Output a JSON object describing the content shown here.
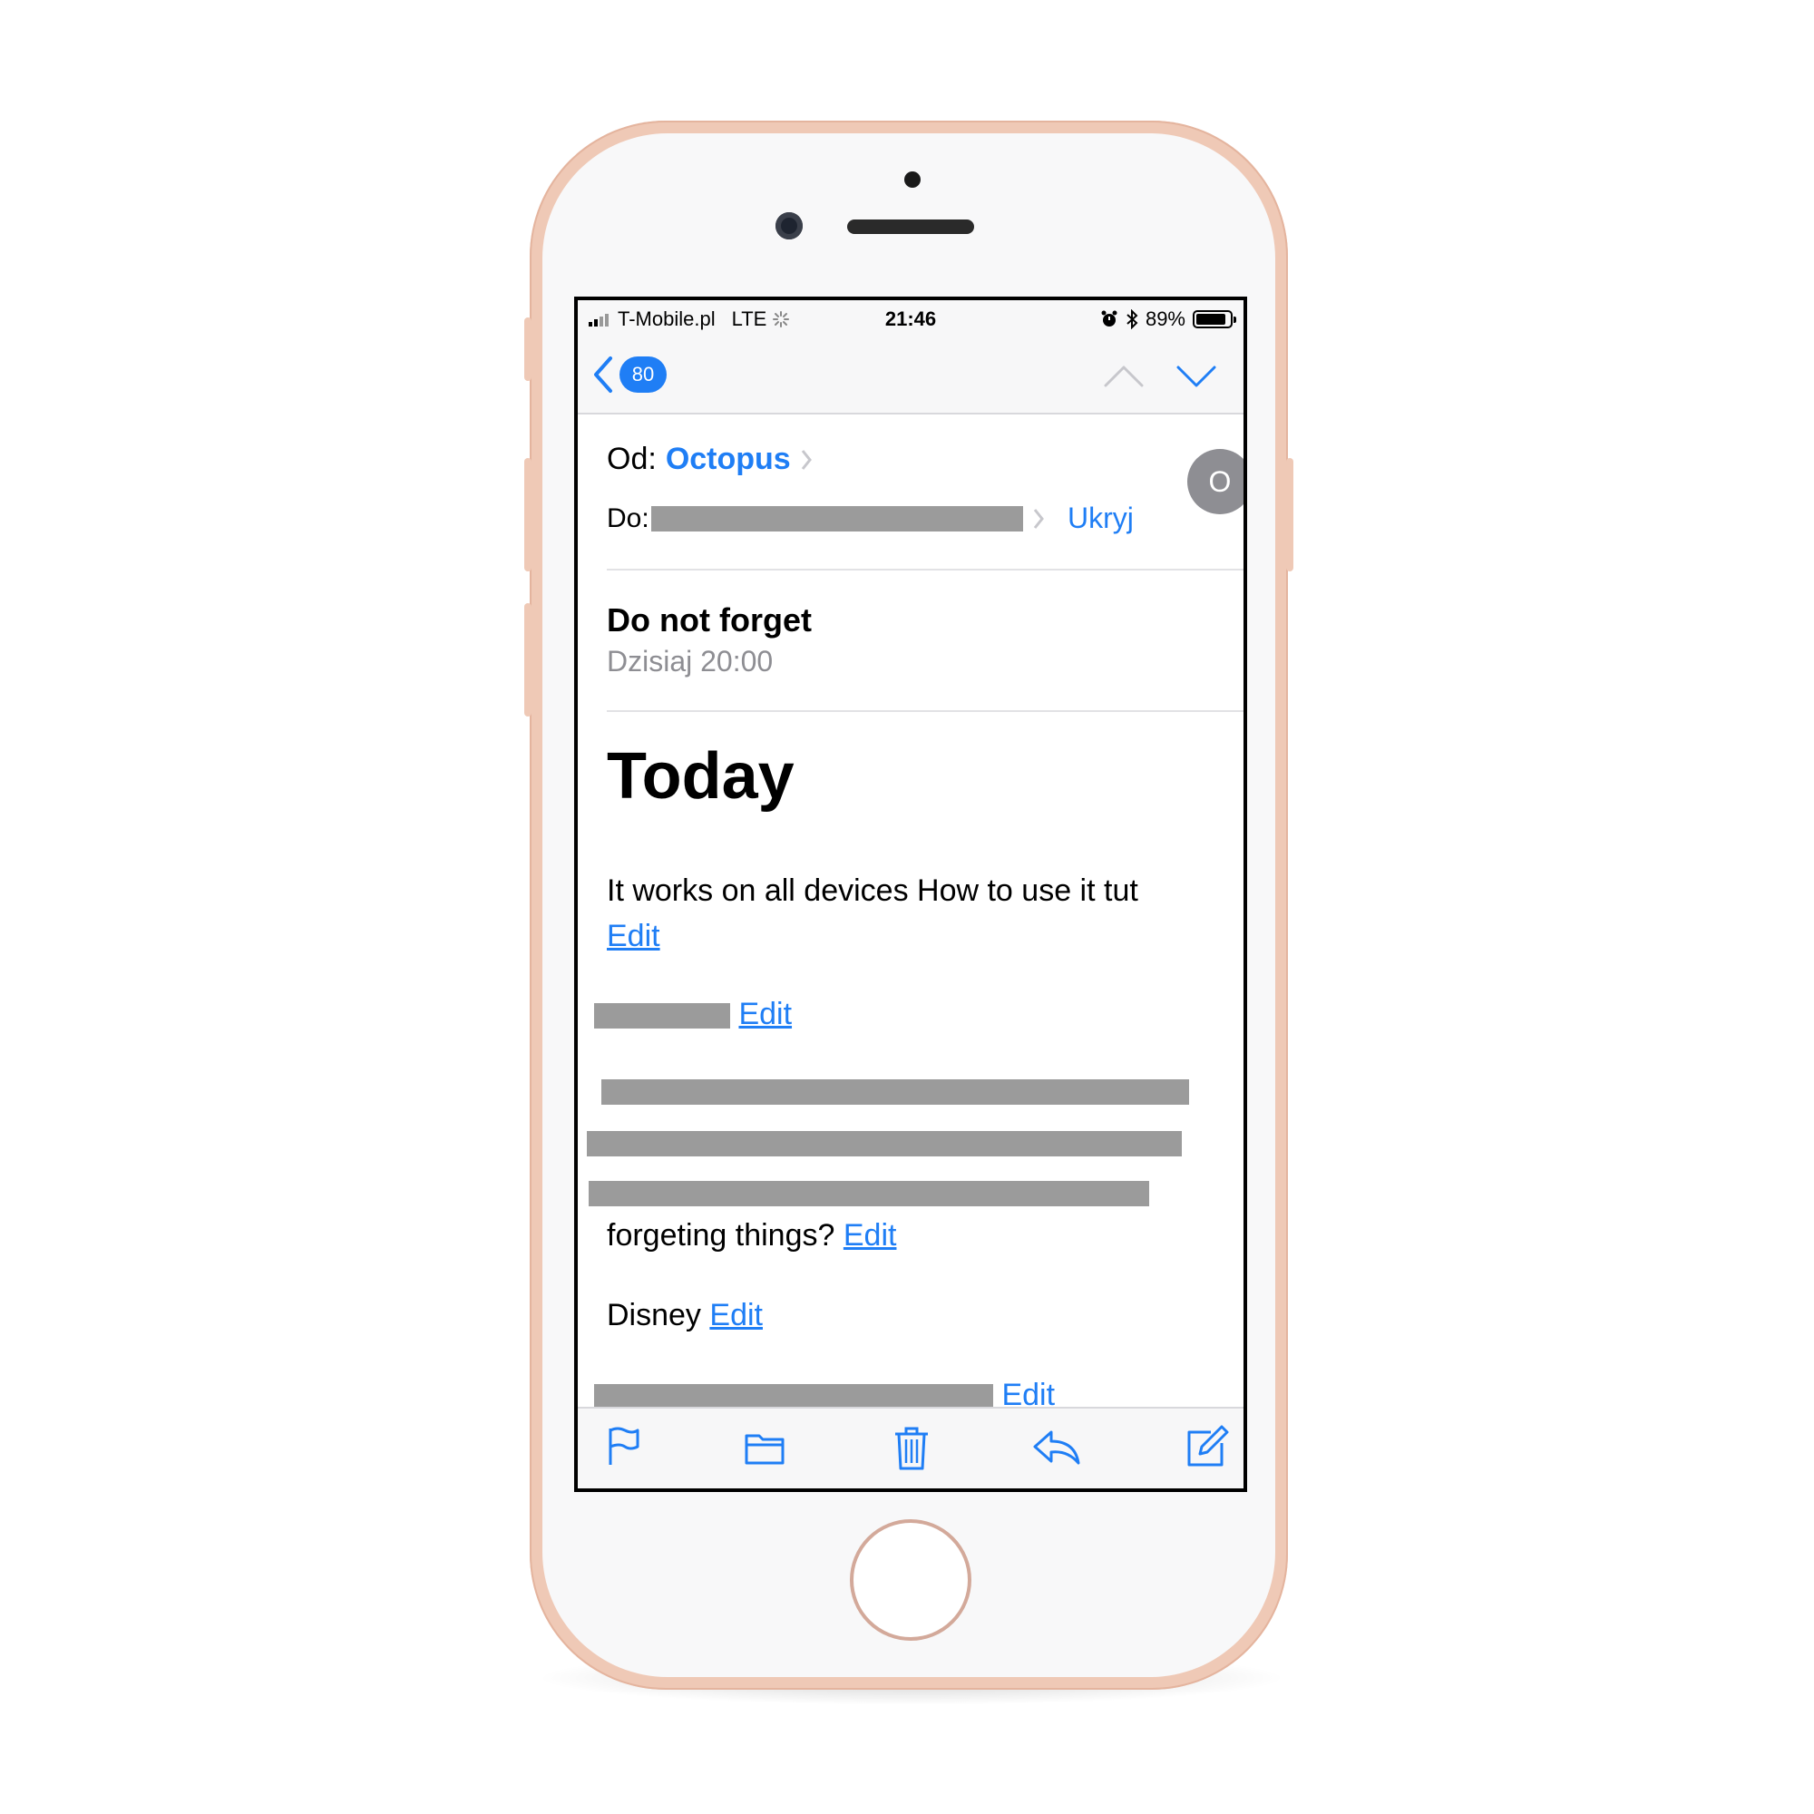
{
  "status": {
    "carrier": "T-Mobile.pl",
    "network": "LTE",
    "time": "21:46",
    "battery": "89%",
    "battery_level": 0.89
  },
  "nav": {
    "unread_count": "80"
  },
  "message": {
    "from_label": "Od:",
    "from_name": "Octopus",
    "to_label": "Do:",
    "hide_label": "Ukryj",
    "avatar_initial": "O",
    "subject": "Do not forget",
    "date": "Dzisiaj 20:00"
  },
  "body": {
    "title": "Today",
    "items": [
      {
        "text": "It works on all devices How to use it tut",
        "link": "Edit"
      },
      {
        "text": "",
        "link": "Edit"
      },
      {
        "text": "forgeting things?",
        "link": "Edit"
      },
      {
        "text": "Disney",
        "link": "Edit"
      },
      {
        "text": "",
        "link": "Edit"
      }
    ]
  },
  "colors": {
    "accent": "#1f7ef5",
    "redaction": "#9b9b9b",
    "frame": "#efc9b6"
  },
  "icons": [
    "back-chevron-icon",
    "up-arrow-icon",
    "down-arrow-icon",
    "flag-icon",
    "folder-icon",
    "trash-icon",
    "reply-icon",
    "compose-icon"
  ]
}
